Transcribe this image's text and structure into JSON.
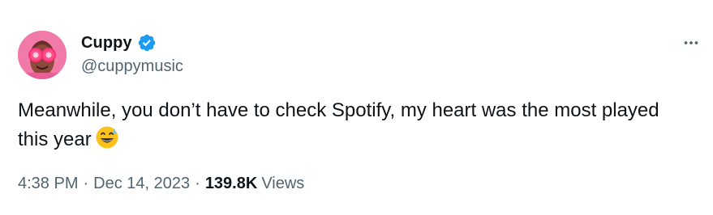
{
  "author": {
    "display_name": "Cuppy",
    "handle": "@cuppymusic",
    "verified": true
  },
  "tweet": {
    "text": "Meanwhile, you don’t have to check Spotify, my heart was the most played this year",
    "emoji": "grinning-face-with-sweat"
  },
  "meta": {
    "time": "4:38 PM",
    "separator": "·",
    "date": "Dec 14, 2023",
    "views_count": "139.8K",
    "views_label": "Views"
  },
  "colors": {
    "verified_blue": "#1d9bf0",
    "text_primary": "#0f1419",
    "text_secondary": "#536471",
    "avatar_pink": "#f27aa8"
  },
  "icons": {
    "more": "more-horizontal-icon",
    "verified": "verified-badge-icon"
  }
}
